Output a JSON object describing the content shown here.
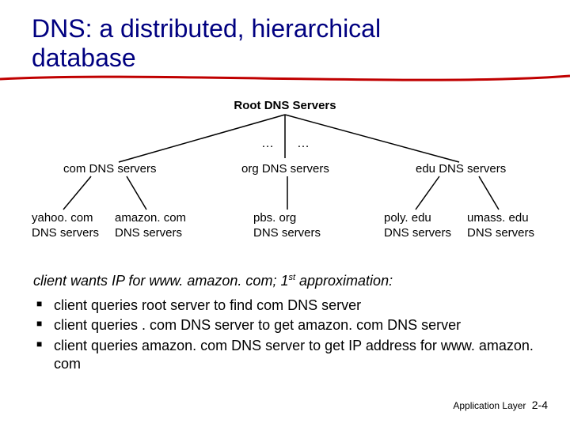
{
  "title_line1": "DNS: a distributed, hierarchical",
  "title_line2": "database",
  "tree": {
    "root": "Root DNS Servers",
    "ellipsis1": "…",
    "ellipsis2": "…",
    "com": "com DNS servers",
    "org": "org DNS servers",
    "edu": "edu DNS servers",
    "yahoo_l1": "yahoo. com",
    "yahoo_l2": "DNS servers",
    "amazon_l1": "amazon. com",
    "amazon_l2": "DNS servers",
    "pbs_l1": "pbs. org",
    "pbs_l2": "DNS servers",
    "poly_l1": "poly. edu",
    "poly_l2": "DNS servers",
    "umass_l1": "umass. edu",
    "umass_l2": "DNS servers"
  },
  "lead_before_sup": "client wants IP for www. amazon. com; 1",
  "lead_sup": "st",
  "lead_after_sup": " approximation:",
  "bullets": [
    "client queries root server to find com DNS server",
    "client queries . com DNS server to get amazon. com DNS server",
    "client queries amazon. com DNS server to get  IP address for www. amazon. com"
  ],
  "footer_label": "Application Layer",
  "footer_page": "2-4"
}
